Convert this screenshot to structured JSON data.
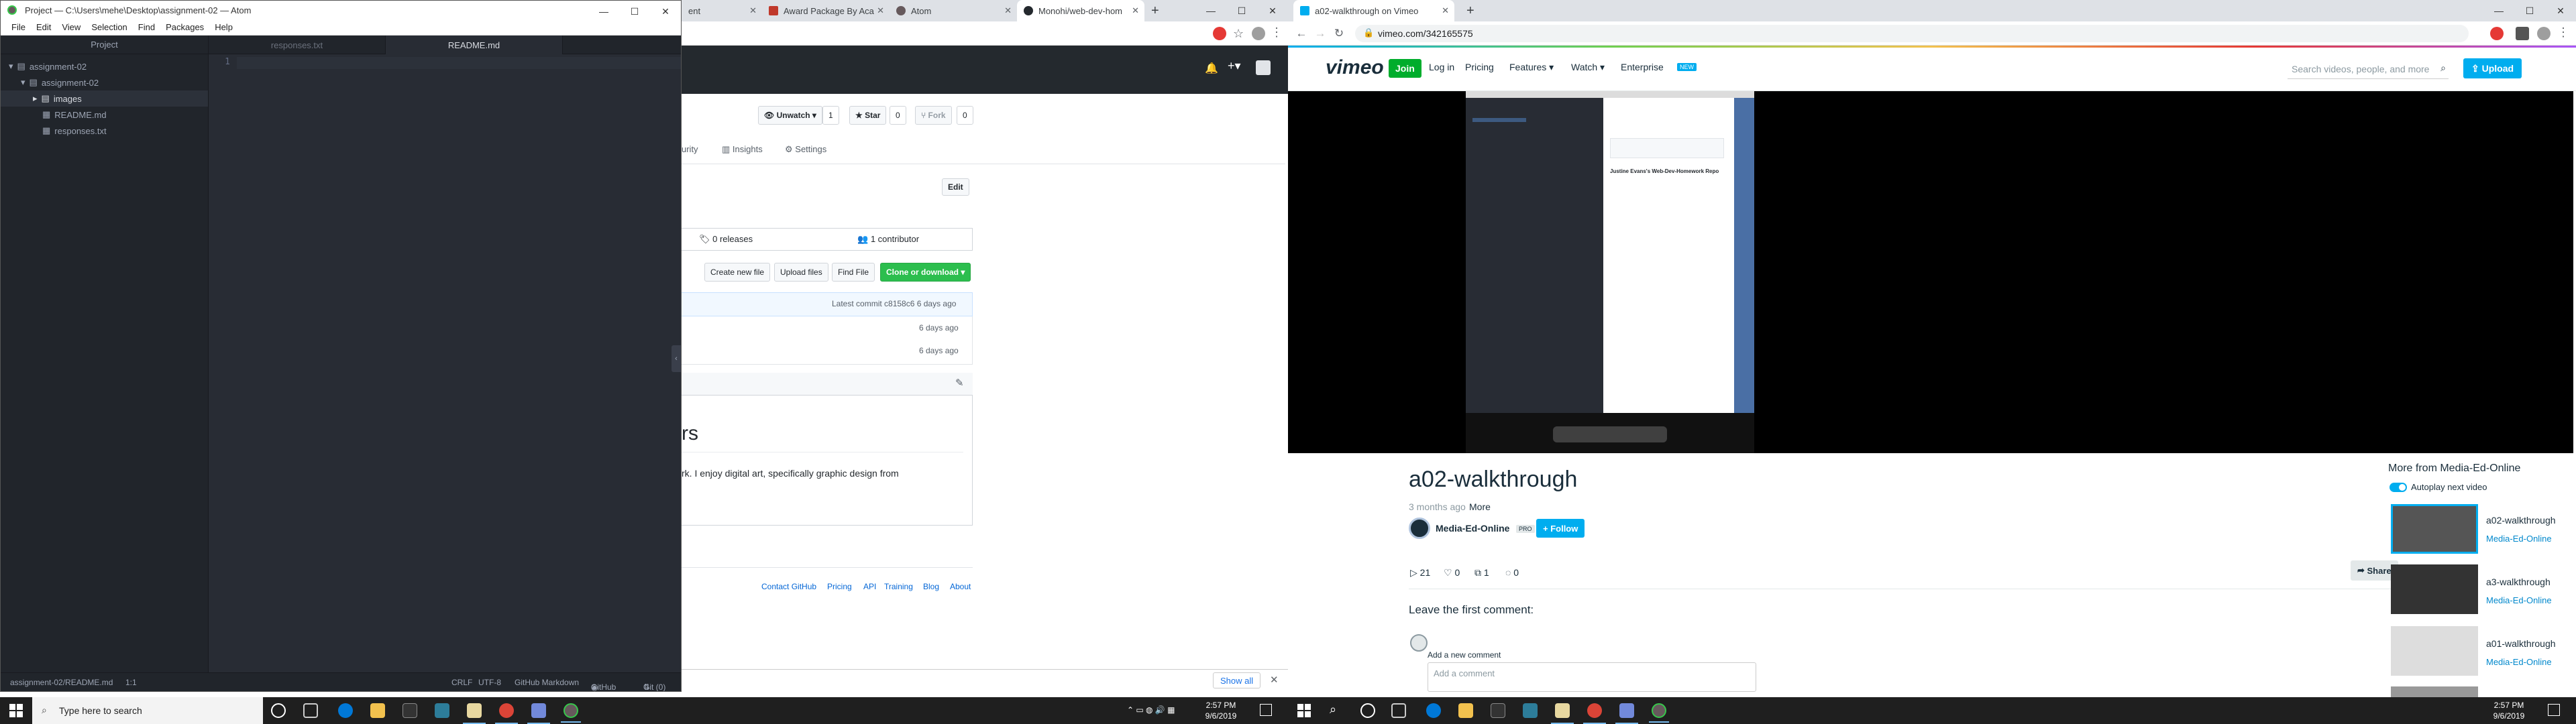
{
  "left_chrome": {
    "tabs": [
      {
        "title": "ent"
      },
      {
        "title": "Award Package By Aca"
      },
      {
        "title": "Atom"
      },
      {
        "title": "Monohi/web-dev-hom"
      }
    ],
    "new_tab": "+"
  },
  "github": {
    "watch_label": "Unwatch ▾",
    "watch_count": "1",
    "star_label": "Star",
    "star_count": "0",
    "fork_label": "Fork",
    "fork_count": "0",
    "tab_security": "urity",
    "tab_insights": "Insights",
    "tab_settings": "Settings",
    "edit_label": "Edit",
    "releases": "0 releases",
    "contributors": "1 contributor",
    "create_file": "Create new file",
    "upload_files": "Upload files",
    "find_file": "Find File",
    "clone": "Clone or download ▾",
    "latest_commit": "Latest commit c8158c6 6 days ago",
    "row_age_1": "6 days ago",
    "row_age_2": "6 days ago",
    "readme_heading": "rs",
    "readme_text": "rk. I enjoy digital art, specifically graphic design from",
    "footer_links": [
      "Contact GitHub",
      "Pricing",
      "API",
      "Training",
      "Blog",
      "About"
    ]
  },
  "atom": {
    "title": "Project — C:\\Users\\mehe\\Desktop\\assignment-02 — Atom",
    "menu": [
      "File",
      "Edit",
      "View",
      "Selection",
      "Find",
      "Packages",
      "Help"
    ],
    "tree_header": "Project",
    "tree": [
      "assignment-02",
      "assignment-02",
      "images",
      "README.md",
      "responses.txt"
    ],
    "tabs": [
      "responses.txt",
      "README.md"
    ],
    "line_number": "1",
    "status_left": "assignment-02/README.md",
    "cursor": "1:1",
    "status_right": [
      "CRLF",
      "UTF-8",
      "GitHub Markdown",
      "GitHub",
      "Git (0)"
    ]
  },
  "notification": {
    "show_all": "Show all",
    "close": "✕"
  },
  "right_chrome": {
    "tab_title": "a02-walkthrough on Vimeo",
    "new_tab": "+",
    "url": "vimeo.com/342165575"
  },
  "vimeo": {
    "logo": "vimeo",
    "join": "Join",
    "nav": [
      "Log in",
      "Pricing",
      "Features ▾",
      "Watch ▾",
      "Enterprise"
    ],
    "new_badge": "NEW",
    "search_placeholder": "Search videos, people, and more",
    "upload": "Upload",
    "video_heading": "Justine Evans's Web-Dev-Homework Repo",
    "title": "a02-walkthrough",
    "age": "3 months ago",
    "more": "More",
    "channel": "Media-Ed-Online",
    "pro_badge": "PRO",
    "follow": "+ Follow",
    "plays": "21",
    "likes": "0",
    "collections": "1",
    "comments": "0",
    "share": "Share",
    "leave_comment": "Leave the first comment:",
    "add_comment_label": "Add a new comment",
    "comment_placeholder": "Add a comment",
    "more_from": "More from Media-Ed-Online",
    "autoplay": "Autoplay next video",
    "related": [
      {
        "title": "a02-walkthrough",
        "channel": "Media-Ed-Online"
      },
      {
        "title": "a3-walkthrough",
        "channel": "Media-Ed-Online"
      },
      {
        "title": "a01-walkthrough",
        "channel": "Media-Ed-Online"
      }
    ]
  },
  "taskbar": {
    "search_placeholder": "Type here to search",
    "time": "2:57 PM",
    "date": "9/6/2019"
  },
  "colors": {
    "atom_bg": "#282c34",
    "github_green": "#2cbe4e",
    "vimeo_blue": "#00adef",
    "vimeo_join": "#00ad2c",
    "taskbar": "#1f1f1f"
  }
}
